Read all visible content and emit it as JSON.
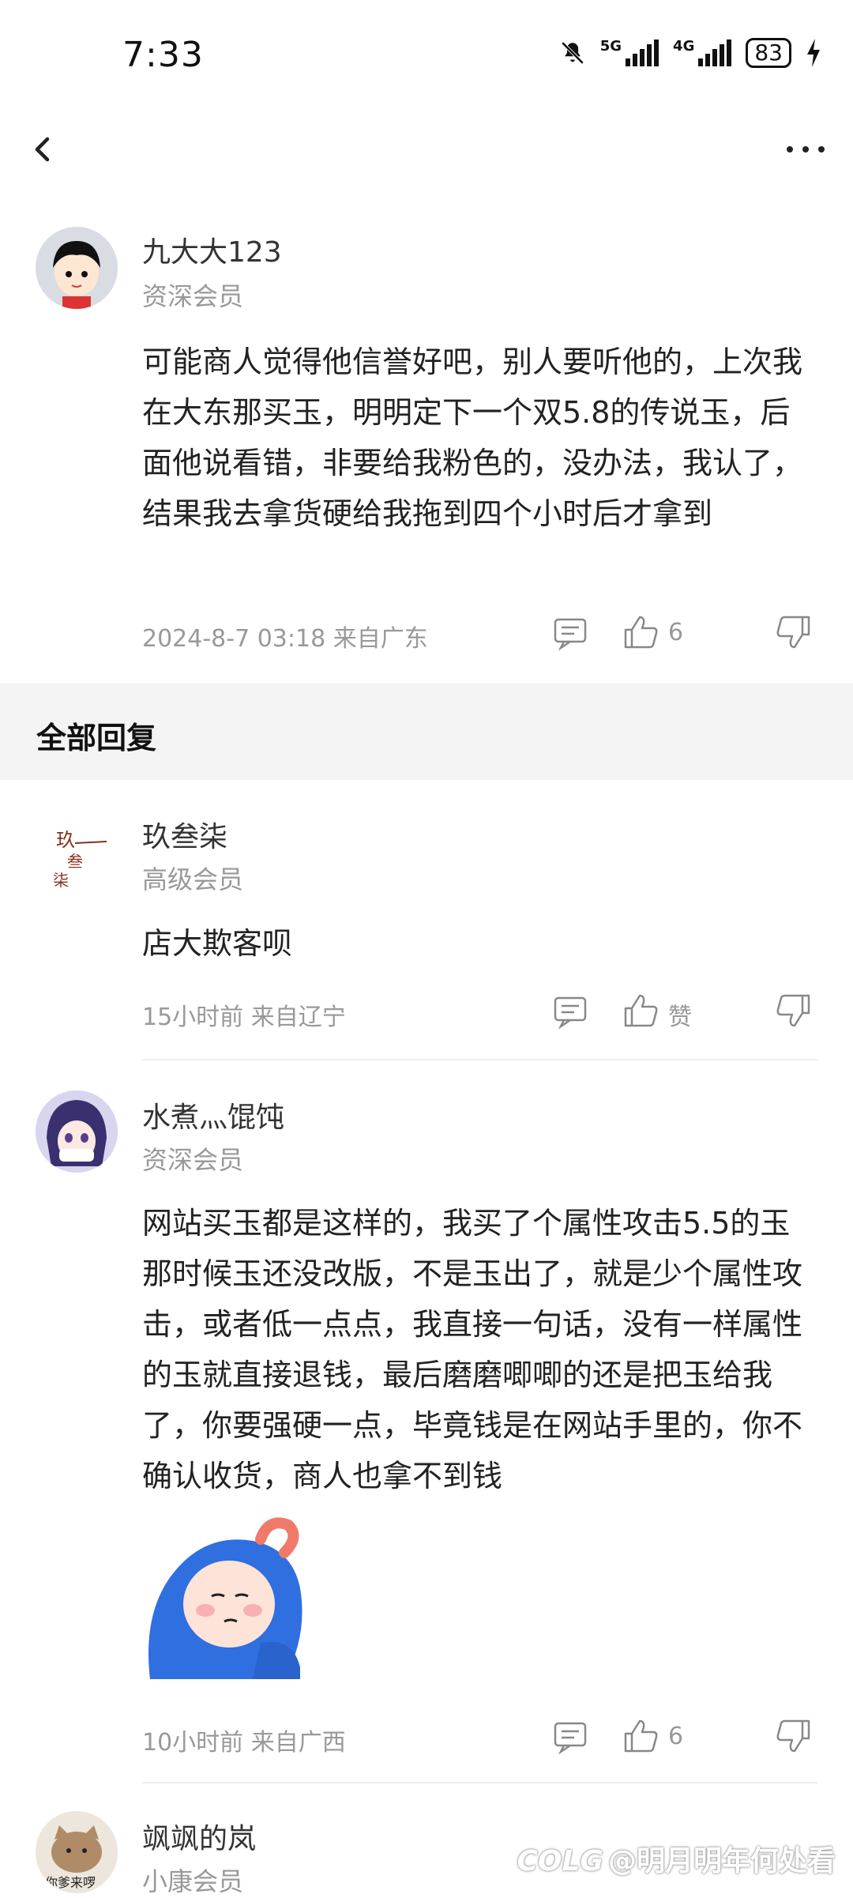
{
  "status_bar": {
    "time": "7:33",
    "network1": "5G",
    "network2": "4G",
    "battery": "83"
  },
  "main_post": {
    "username": "九大大123",
    "rank": "资深会员",
    "content": "可能商人觉得他信誉好吧，别人要听他的，上次我在大东那买玉，明明定下一个双5.8的传说玉，后面他说看错，非要给我粉色的，没办法，我认了，结果我去拿货硬给我拖到四个小时后才拿到",
    "meta": "2024-8-7 03:18  来自广东",
    "likes": "6"
  },
  "section": {
    "title": "全部回复"
  },
  "replies": [
    {
      "username": "玖叁柒",
      "rank": "高级会员",
      "content": "店大欺客呗",
      "meta": "15小时前 来自辽宁",
      "likes": "赞"
    },
    {
      "username": "水煮灬馄饨",
      "rank": "资深会员",
      "content": "网站买玉都是这样的，我买了个属性攻击5.5的玉那时候玉还没改版，不是玉出了，就是少个属性攻击，或者低一点点，我直接一句话，没有一样属性的玉就直接退钱，最后磨磨唧唧的还是把玉给我了，你要强硬一点，毕竟钱是在网站手里的，你不确认收货，商人也拿不到钱",
      "meta": "10小时前 来自广西",
      "likes": "6"
    },
    {
      "username": "飒飒的岚",
      "rank": "小康会员"
    }
  ],
  "watermark": "@明月明年何处看",
  "watermark_logo": "COLG"
}
